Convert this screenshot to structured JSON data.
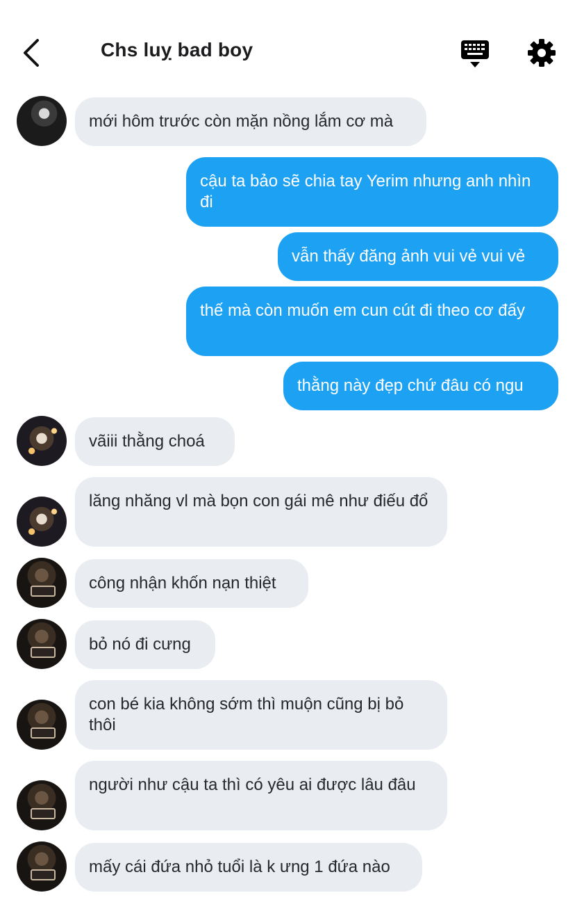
{
  "header": {
    "title": "Chs luỵ bad boy",
    "back_icon": "chevron-left-icon",
    "keyboard_icon": "keyboard-icon",
    "settings_icon": "gear-icon"
  },
  "colors": {
    "incoming_bubble": "#e9edf1",
    "outgoing_bubble": "#1da1f2",
    "outgoing_text": "#ffffff"
  },
  "messages": [
    {
      "direction": "in",
      "text": "mới hôm trước còn mặn nồng lắm cơ mà"
    },
    {
      "direction": "out",
      "text": "cậu ta bảo sẽ chia tay Yerim nhưng anh nhìn đi"
    },
    {
      "direction": "out",
      "text": "vẫn thấy đăng ảnh vui vẻ vui vẻ"
    },
    {
      "direction": "out",
      "text": "thế mà còn muốn em cun cút đi theo cơ đấy"
    },
    {
      "direction": "out",
      "text": "thằng này đẹp chứ đâu có ngu"
    },
    {
      "direction": "in",
      "text": "vãiii thằng choá"
    },
    {
      "direction": "in",
      "text": "lăng nhăng vl mà bọn con gái mê như điếu đổ"
    },
    {
      "direction": "in",
      "text": "công nhận khốn nạn thiệt"
    },
    {
      "direction": "in",
      "text": "bỏ nó đi cưng"
    },
    {
      "direction": "in",
      "text": "con bé kia không sớm thì muộn cũng bị bỏ thôi"
    },
    {
      "direction": "in",
      "text": "người như cậu ta thì có yêu ai được lâu đâu"
    },
    {
      "direction": "in",
      "text": "mấy cái đứa nhỏ tuổi là k ưng 1 đứa nào"
    }
  ]
}
